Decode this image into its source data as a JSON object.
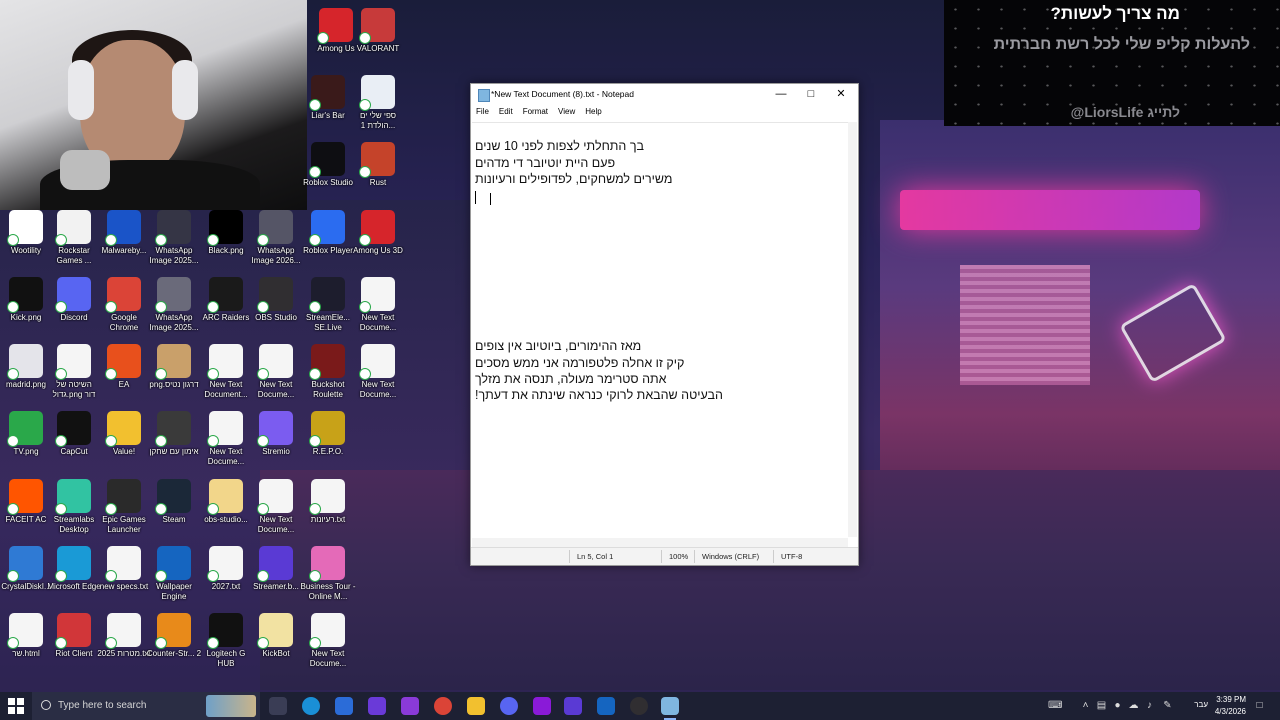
{
  "overlay": {
    "title": "מה צריך לעשות?",
    "subtitle": "להעלות קליפ שלי לכל רשת חברתית",
    "handle": "@LiorsLife לתייג"
  },
  "desktop_icons": [
    {
      "id": "among-us",
      "label": "Among Us",
      "color": "#d6252b"
    },
    {
      "id": "valorant",
      "label": "VALORANT",
      "color": "#c73a3a"
    },
    {
      "id": "liars-bar",
      "label": "Liar's Bar",
      "color": "#3a1a1a"
    },
    {
      "id": "birthday-list",
      "label": "ספי שלי ים הולדת 1...",
      "color": "#e9eef5"
    },
    {
      "id": "roblox-studio",
      "label": "Roblox Studio",
      "color": "#0e0e12"
    },
    {
      "id": "rust",
      "label": "Rust",
      "color": "#c5432a"
    },
    {
      "id": "wootility",
      "label": "Wootility",
      "color": "#ffffff"
    },
    {
      "id": "rockstar",
      "label": "Rockstar Games ...",
      "color": "#f2f2f2"
    },
    {
      "id": "malwarebytes",
      "label": "Malwareby...",
      "color": "#1a54c8"
    },
    {
      "id": "whatsapp-1",
      "label": "WhatsApp Image 2025...",
      "color": "#353545"
    },
    {
      "id": "black-png",
      "label": "Black.png",
      "color": "#000000"
    },
    {
      "id": "whatsapp-2",
      "label": "WhatsApp Image 2026...",
      "color": "#555566"
    },
    {
      "id": "roblox-player",
      "label": "Roblox Player",
      "color": "#2b6cf0"
    },
    {
      "id": "among-us-3d",
      "label": "Among Us 3D",
      "color": "#d6252b"
    },
    {
      "id": "kick-png",
      "label": "Kick.png",
      "color": "#111111"
    },
    {
      "id": "discord",
      "label": "Discord",
      "color": "#5865f2"
    },
    {
      "id": "chrome",
      "label": "Google Chrome",
      "color": "#db4437"
    },
    {
      "id": "whatsapp-3",
      "label": "WhatsApp Image 2025...",
      "color": "#6a6a7a"
    },
    {
      "id": "arc-raiders",
      "label": "ARC Raiders",
      "color": "#1a1a1a"
    },
    {
      "id": "obs",
      "label": "OBS Studio",
      "color": "#302e31"
    },
    {
      "id": "streamelements",
      "label": "StreamEle... SE.Live",
      "color": "#1d1d2d"
    },
    {
      "id": "new-text-1",
      "label": "New Text Docume...",
      "color": "#f5f5f5"
    },
    {
      "id": "madrid",
      "label": "madrid.png",
      "color": "#e4e4ea"
    },
    {
      "id": "hebrew-png",
      "label": "השיטה של גדול.png דור",
      "color": "#f5f5f5"
    },
    {
      "id": "ea",
      "label": "EA",
      "color": "#e8501c"
    },
    {
      "id": "hebrew-png-2",
      "label": "png.דרגון נטיס",
      "color": "#c9a06a"
    },
    {
      "id": "new-text-2",
      "label": "New Text Document...",
      "color": "#f5f5f5"
    },
    {
      "id": "new-text-3",
      "label": "New Text Docume...",
      "color": "#f5f5f5"
    },
    {
      "id": "buckshot",
      "label": "Buckshot Roulette",
      "color": "#7a1a1a"
    },
    {
      "id": "new-text-4",
      "label": "New Text Docume...",
      "color": "#f5f5f5"
    },
    {
      "id": "tv-png",
      "label": "TV.png",
      "color": "#2aa84a"
    },
    {
      "id": "capcut",
      "label": "CapCut",
      "color": "#111111"
    },
    {
      "id": "value",
      "label": "Value!",
      "color": "#f2c02f"
    },
    {
      "id": "hebrew-shortcut",
      "label": "אימון עם שחקן",
      "color": "#3a3a3a"
    },
    {
      "id": "new-text-5",
      "label": "New Text Docume...",
      "color": "#f5f5f5"
    },
    {
      "id": "stremio",
      "label": "Stremio",
      "color": "#7b5cf0"
    },
    {
      "id": "repo",
      "label": "R.E.P.O.",
      "color": "#c8a218"
    },
    {
      "id": "faceit",
      "label": "FACEIT AC",
      "color": "#ff5500"
    },
    {
      "id": "streamlabs",
      "label": "Streamlabs Desktop",
      "color": "#31c3a2"
    },
    {
      "id": "epic",
      "label": "Epic Games Launcher",
      "color": "#2a2a2a"
    },
    {
      "id": "steam",
      "label": "Steam",
      "color": "#1b2838"
    },
    {
      "id": "obs-studio-file",
      "label": "obs-studio...",
      "color": "#f2d68a"
    },
    {
      "id": "new-text-6",
      "label": "New Text Docume...",
      "color": "#f5f5f5"
    },
    {
      "id": "ideas-txt",
      "label": "רעיונות.txt",
      "color": "#f5f5f5"
    },
    {
      "id": "crystaldisk",
      "label": "CrystalDiskI...",
      "color": "#2f7ad4"
    },
    {
      "id": "edge",
      "label": "Microsoft Edge",
      "color": "#1a9ad6"
    },
    {
      "id": "new-specs",
      "label": "new specs.txt",
      "color": "#f5f5f5"
    },
    {
      "id": "wallpaper-engine",
      "label": "Wallpaper Engine",
      "color": "#1565c0"
    },
    {
      "id": "2027-txt",
      "label": "2027.txt",
      "color": "#f5f5f5"
    },
    {
      "id": "streamerbot",
      "label": "Streamer.b...",
      "color": "#5a3ad4"
    },
    {
      "id": "business-tour",
      "label": "Business Tour - Online M...",
      "color": "#e46ab8"
    },
    {
      "id": "shir-html",
      "label": "שר.html",
      "color": "#f5f5f5"
    },
    {
      "id": "riot",
      "label": "Riot Client",
      "color": "#d13639"
    },
    {
      "id": "goals-2025",
      "label": "מטרות 2025.txt",
      "color": "#f5f5f5"
    },
    {
      "id": "cs2",
      "label": "Counter-Str... 2",
      "color": "#e88a1a"
    },
    {
      "id": "logitech",
      "label": "Logitech G HUB",
      "color": "#111111"
    },
    {
      "id": "kickbot",
      "label": "KickBot",
      "color": "#f2e2a2"
    },
    {
      "id": "new-text-7",
      "label": "New Text Docume...",
      "color": "#f5f5f5"
    }
  ],
  "notepad": {
    "title": "*New Text Document (8).txt - Notepad",
    "menu": [
      "File",
      "Edit",
      "Format",
      "View",
      "Help"
    ],
    "lines_top": [
      "בך התחלתי לצפות לפני 10 שנים",
      "פעם היית יוטיובר די מדהים",
      "משירים למשחקים, לפדופילים ורעיונות"
    ],
    "lines_bottom": [
      "מאז ההימורים, ביוטיוב אין צופים",
      "קיק זו אחלה פלטפורמה אני ממש מסכים",
      "אתה סטרימר מעולה, תנסה את מזלך",
      "הבעיטה שהבאת לרוקי כנראה שינתה את דעתך!"
    ],
    "status": {
      "position": "Ln 5, Col 1",
      "zoom": "100%",
      "eol": "Windows (CRLF)",
      "encoding": "UTF-8"
    }
  },
  "taskbar": {
    "search_placeholder": "Type here to search",
    "lang": "עבר",
    "time": "3:39 PM",
    "date": "4/3/2026"
  }
}
